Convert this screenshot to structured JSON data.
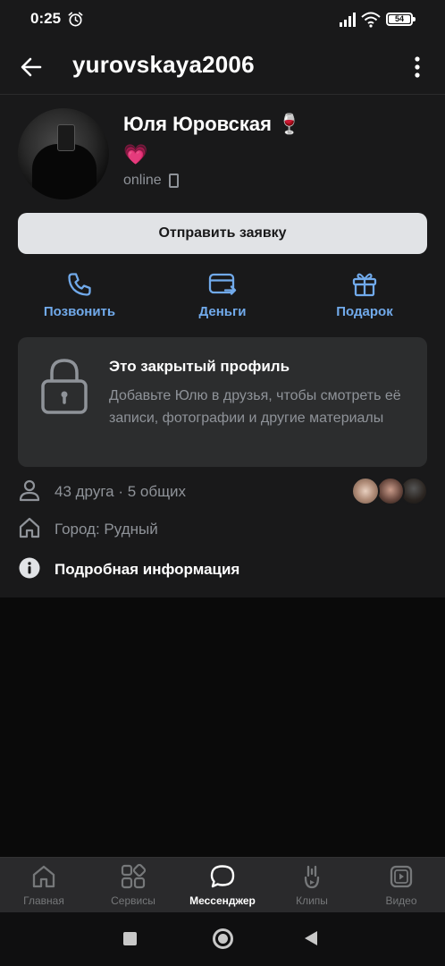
{
  "status_bar": {
    "time": "0:25",
    "battery": "54",
    "icons": [
      "alarm-icon",
      "signal-icon",
      "wifi-icon",
      "battery-icon"
    ]
  },
  "header": {
    "username": "yurovskaya2006",
    "back_icon": "arrow-left-icon",
    "menu_icon": "more-vertical-icon"
  },
  "profile": {
    "name": "Юля Юровская 🍷",
    "status_emoji": "💗",
    "online_text": "online",
    "online_device_icon": "mobile-phone-icon"
  },
  "send_request_button": "Отправить заявку",
  "actions": [
    {
      "label": "Позвонить",
      "icon": "phone-icon"
    },
    {
      "label": "Деньги",
      "icon": "money-transfer-icon"
    },
    {
      "label": "Подарок",
      "icon": "gift-icon"
    }
  ],
  "private_profile": {
    "title": "Это закрытый профиль",
    "text": "Добавьте Юлю в друзья, чтобы смотреть её записи, фотографии и другие материалы",
    "icon": "lock-icon"
  },
  "info": {
    "friends": "43 друга · 5 общих",
    "city": "Город: Рудный",
    "details": "Подробная информация"
  },
  "bottom_nav": [
    {
      "label": "Главная",
      "icon": "home-icon",
      "active": false
    },
    {
      "label": "Сервисы",
      "icon": "services-icon",
      "active": false
    },
    {
      "label": "Мессенджер",
      "icon": "messenger-icon",
      "active": true
    },
    {
      "label": "Клипы",
      "icon": "clips-icon",
      "active": false
    },
    {
      "label": "Видео",
      "icon": "video-icon",
      "active": false
    }
  ],
  "colors": {
    "background": "#19191a",
    "accent": "#71aaeb",
    "card": "#2c2d2e",
    "text_secondary": "#8f9399"
  }
}
